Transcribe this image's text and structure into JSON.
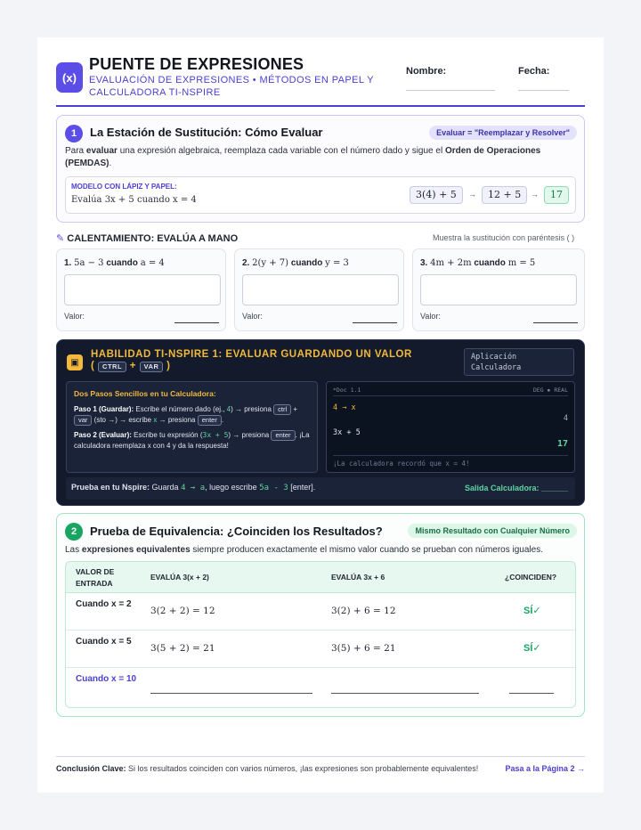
{
  "header": {
    "logo": "(x)",
    "title": "PUENTE DE EXPRESIONES",
    "subtitle": "EVALUACIÓN DE EXPRESIONES • MÉTODOS EN PAPEL Y CALCULADORA TI-NSPIRE",
    "name_label": "Nombre:",
    "date_label": "Fecha:"
  },
  "section1": {
    "number": "1",
    "title": "La Estación de Sustitución: Cómo Evaluar",
    "badge": "Evaluar = \"Reemplazar y Resolver\"",
    "desc_pre": "Para ",
    "desc_b1": "evaluar",
    "desc_mid": " una expresión algebraica, reemplaza cada variable con el número dado y sigue el ",
    "desc_b2": "Orden de Operaciones (PEMDAS)",
    "desc_end": ".",
    "model_label": "MODELO CON LÁPIZ Y PAPEL:",
    "model_text": "Evalúa 3x + 5 cuando x = 4",
    "chain": [
      "3(4) + 5",
      "12 + 5",
      "17"
    ],
    "arrow": "→"
  },
  "warmup": {
    "title": "CALENTAMIENTO: EVALÚA A MANO",
    "note": "Muestra la sustitución con paréntesis ( )",
    "items": [
      {
        "num": "1.",
        "expr": "5a − 3",
        "word": "cuando",
        "cond": "a = 4",
        "value_label": "Valor:"
      },
      {
        "num": "2.",
        "expr": "2(y + 7)",
        "word": "cuando",
        "cond": "y = 3",
        "value_label": "Valor:"
      },
      {
        "num": "3.",
        "expr": "4m + 2m",
        "word": "cuando",
        "cond": "m = 5",
        "value_label": "Valor:"
      }
    ]
  },
  "ti": {
    "title": "HABILIDAD TI-NSPIRE 1: EVALUAR GUARDANDO UN VALOR",
    "key1": "CTRL",
    "plus": "+",
    "key2": "VAR",
    "app_label": "Aplicación Calculadora",
    "steps_title": "Dos Pasos Sencillos en tu Calculadora:",
    "step1_b": "Paso 1 (Guardar):",
    "step1_a": " Escribe el número dado (ej., ",
    "step1_num": "4",
    "step1_c": ") → presiona",
    "key_ctrl": "ctrl",
    "key_var": "var",
    "step1_d": "(sto →) → escribe",
    "step1_x": "x",
    "step1_e": "→ presiona",
    "key_enter": "enter",
    "step2_b": "Paso 2 (Evaluar):",
    "step2_a": " Escribe tu expresión (",
    "step2_expr": "3x + 5",
    "step2_c": ") → presiona",
    "step2_d": ". ¡La calculadora reemplaza x con 4 y da la respuesta!",
    "screen_doc": "*Doc 1.1",
    "screen_mode": "DEG ▪ REAL",
    "screen_in1": "4 → x",
    "screen_out1": "4",
    "screen_in2": "3x + 5",
    "screen_out2": "17",
    "screen_msg": "¡La calculadora recordó que x = 4!",
    "foot_b": "Prueba en tu Nspire:",
    "foot_a": " Guarda ",
    "foot_g1": "4 → a",
    "foot_c": ", luego escribe ",
    "foot_g2": "5a - 3",
    "foot_d": " [enter].",
    "foot_out": "Salida Calculadora: ______"
  },
  "section2": {
    "number": "2",
    "title": "Prueba de Equivalencia: ¿Coinciden los Resultados?",
    "badge": "Mismo Resultado con Cualquier Número",
    "desc_a": "Las ",
    "desc_b": "expresiones equivalentes",
    "desc_c": " siempre producen exactamente el mismo valor cuando se prueban con números iguales.",
    "col1": "VALOR DE ENTRADA",
    "col2": "EVALÚA 3(x + 2)",
    "col3": "EVALÚA 3x + 6",
    "col4": "¿COINCIDEN?",
    "rows": [
      {
        "input": "Cuando x = 2",
        "e1": "3(2 + 2) = 12",
        "e2": "3(2) + 6 = 12",
        "match": "SÍ✓"
      },
      {
        "input": "Cuando x = 5",
        "e1": "3(5 + 2) = 21",
        "e2": "3(5) + 6 = 21",
        "match": "SÍ✓"
      },
      {
        "input": "Cuando x = 10",
        "e1": "",
        "e2": "",
        "match": ""
      }
    ]
  },
  "conclusion": {
    "label": "Conclusión Clave:",
    "text": " Si los resultados coinciden con varios números, ¡las expresiones son probablemente equivalentes!",
    "next": "Pasa a la Página 2 →"
  }
}
